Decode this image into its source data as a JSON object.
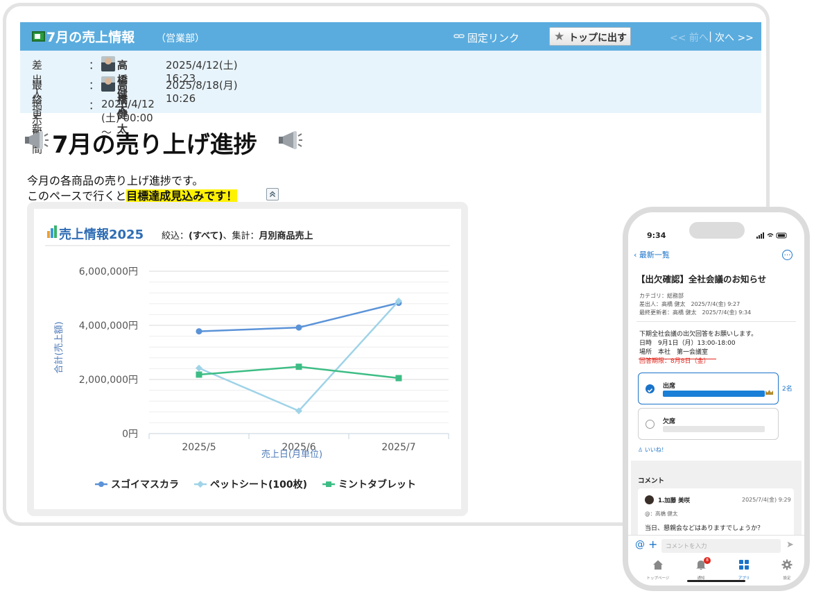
{
  "desktop": {
    "header": {
      "title": "7月の売上情報",
      "department": "（営業部）",
      "permalink": "固定リンク",
      "pin_button": "トップに出す",
      "prev": "<< 前へ",
      "separator": "|",
      "next": "次へ >>"
    },
    "meta": {
      "sender_label": "差出人",
      "updater_label": "最終更新者",
      "period_label": "掲示期間",
      "colon": "：",
      "sender_name": "高橋 健太",
      "sender_date": "2025/4/12(土) 16:23",
      "updater_name": "高橋 健太",
      "updater_date": "2025/8/18(月) 10:26",
      "period_value": "2025/4/12 (土) 00:00　～"
    },
    "post": {
      "title": "7月の売り上げ進捗",
      "intro_line1": "今月の各商品の売り上げ進捗です。",
      "intro_line2_prefix": "このペースで行くと",
      "intro_line2_highlight": "目標達成見込みです！"
    },
    "chart_header": {
      "title": "売上情報2025",
      "filter_label": "絞込：",
      "filter_value": "(すべて)",
      "agg_label": "、集計：",
      "agg_value": "月別商品売上"
    }
  },
  "chart_data": {
    "type": "line",
    "categories": [
      "2025/5",
      "2025/6",
      "2025/7"
    ],
    "series": [
      {
        "name": "スゴイマスカラ",
        "values": [
          3780000,
          3920000,
          4830000
        ],
        "color": "#5b93d8",
        "marker": "circle"
      },
      {
        "name": "ペットシート(100枚)",
        "values": [
          2420000,
          840000,
          4900000
        ],
        "color": "#9fd3e8",
        "marker": "diamond"
      },
      {
        "name": "ミントタブレット",
        "values": [
          2180000,
          2470000,
          2050000
        ],
        "color": "#3dbd85",
        "marker": "square"
      }
    ],
    "ylim": [
      0,
      6000000
    ],
    "yticks": [
      0,
      2000000,
      4000000,
      6000000
    ],
    "ytick_labels": [
      "0円",
      "2,000,000円",
      "4,000,000円",
      "6,000,000円"
    ],
    "xlabel": "売上日(月単位)",
    "ylabel": "合計(売上額)",
    "grid": true,
    "legend_position": "bottom"
  },
  "phone": {
    "time": "9:34",
    "back_label": "最新一覧",
    "more_label": "…",
    "title": "【出欠確認】全社会議のお知らせ",
    "category": "カテゴリ：総務部",
    "sender": "差出人：高橋 健太　2025/7/4(金) 9:27",
    "updater": "最終更新者：高橋 健太　2025/7/4(金) 9:34",
    "body1": "下期全社会議の出欠回答をお願いします。",
    "body2": "日時　9月1日（月）13:00-18:00",
    "body3": "場所　本社　第一会議室",
    "deadline": "回答期限：8月8日（金）",
    "option_yes": "出席",
    "option_no": "欠席",
    "yes_count": "2名",
    "yes_progress": 1.0,
    "no_progress": 0.0,
    "like": "いいね！",
    "comments_header": "コメント",
    "comment": {
      "name": "1.加藤 美咲",
      "date": "2025/7/4(金) 9:29",
      "to": "@：高橋 健太",
      "text": "当日、懇親会などはありますでしょうか？"
    },
    "input_at": "@",
    "input_plus": "+",
    "input_placeholder": "コメントを入力",
    "send_icon": "➤",
    "tabs": [
      {
        "label": "トップページ",
        "icon": "home-icon"
      },
      {
        "label": "通知",
        "icon": "bell-icon",
        "badge": "8"
      },
      {
        "label": "アプリ",
        "icon": "grid-icon"
      },
      {
        "label": "設定",
        "icon": "gear-icon"
      }
    ],
    "colors": {
      "accent": "#1a73c9",
      "alert": "#e0261d"
    }
  },
  "colors": {
    "header_bg": "#5aacde",
    "meta_bg": "#e8f4fb",
    "highlight": "#fff200"
  }
}
